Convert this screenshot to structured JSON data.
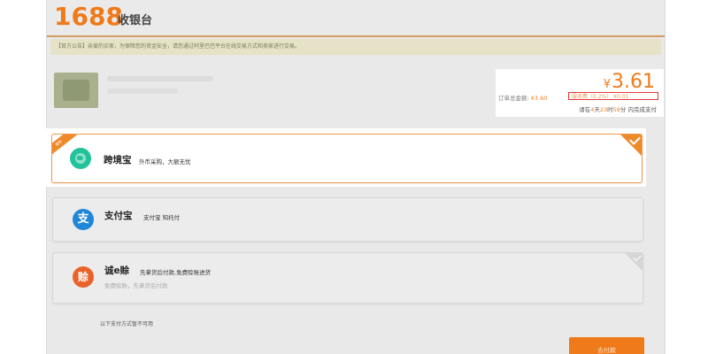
{
  "header": {
    "logo": "1688",
    "title": "收银台"
  },
  "notice": {
    "text": "【官方公告】亲爱的买家，为保障您的资金安全，请您通过阿里巴巴平台在线交易方式和卖家进行交易。"
  },
  "order": {
    "currency_symbol": "¥",
    "total_display": "3.61",
    "total_label": "订单总金额:",
    "subtotal": "¥3.60",
    "service_fee": "服务费（0.2%） ¥0.01",
    "deadline_prefix": "请在",
    "deadline_days": "4",
    "deadline_days_unit": "天",
    "deadline_hours": "23",
    "deadline_hours_unit": "时",
    "deadline_minutes": "59",
    "deadline_minutes_unit": "分",
    "deadline_suffix": " 内完成支付"
  },
  "payment_methods": [
    {
      "name": "跨境宝",
      "desc": "外币采购，大额无忧",
      "ribbon": "推荐",
      "icon": "globe-icon",
      "color": "#22c29a",
      "selected": true
    },
    {
      "name": "支付宝",
      "desc": "支付宝 知托付",
      "icon": "alipay-icon",
      "icon_glyph": "支",
      "color": "#1f86d8",
      "selected": false
    },
    {
      "name": "诚e赊",
      "desc": "先拿货后付款,免费赊账进货",
      "desc2": "免费赊账，先拿货后付款",
      "icon": "cheng-icon",
      "icon_glyph": "赊",
      "color": "#e8622a",
      "selected": false
    }
  ],
  "unavailable_label": "以下支付方式暂不可用",
  "confirm_button": "去付款",
  "colors": {
    "accent": "#ef7a1a",
    "highlight_border": "#e13a3a"
  }
}
